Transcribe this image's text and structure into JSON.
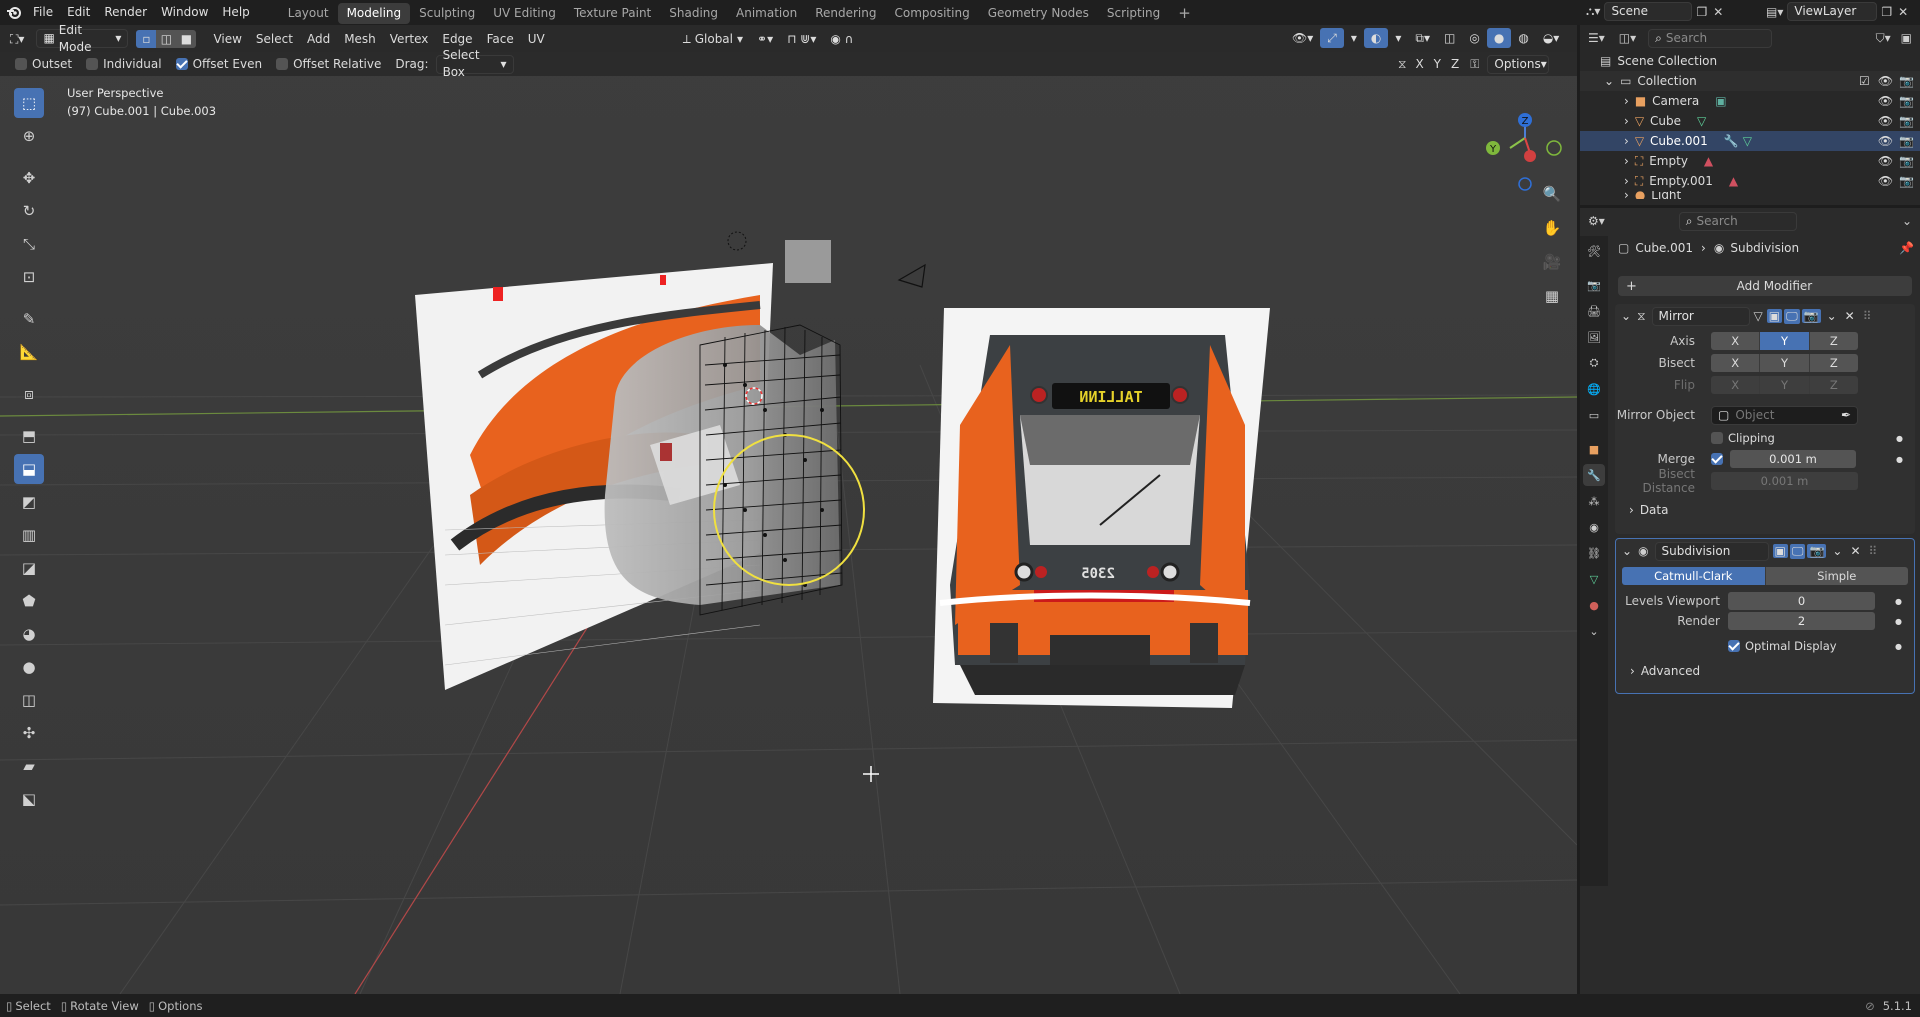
{
  "topbar": {
    "menus": [
      "File",
      "Edit",
      "Render",
      "Window",
      "Help"
    ],
    "workspaces": [
      "Layout",
      "Modeling",
      "Sculpting",
      "UV Editing",
      "Texture Paint",
      "Shading",
      "Animation",
      "Rendering",
      "Compositing",
      "Geometry Nodes",
      "Scripting"
    ],
    "active_workspace": "Modeling",
    "scene": "Scene",
    "view_layer": "ViewLayer"
  },
  "viewport_header": {
    "mode": "Edit Mode",
    "menus": [
      "View",
      "Select",
      "Add",
      "Mesh",
      "Vertex",
      "Edge",
      "Face",
      "UV"
    ],
    "orientation": "Global"
  },
  "tool_settings": {
    "outset": "Outset",
    "individual": "Individual",
    "offset_even": "Offset Even",
    "offset_relative": "Offset Relative",
    "drag_label": "Drag:",
    "drag_value": "Select Box",
    "axis_x": "X",
    "axis_y": "Y",
    "axis_z": "Z",
    "options": "Options"
  },
  "overlay": {
    "view_name": "User Perspective",
    "object_info": "(97) Cube.001 | Cube.003"
  },
  "train_image": {
    "destination": "TALLINN",
    "number": "2305"
  },
  "outliner": {
    "search_placeholder": "Search",
    "root": "Scene Collection",
    "collection": "Collection",
    "items": [
      "Camera",
      "Cube",
      "Cube.001",
      "Empty",
      "Empty.001",
      "Light"
    ]
  },
  "properties": {
    "search_placeholder": "Search",
    "breadcrumb_object": "Cube.001",
    "breadcrumb_modifier": "Subdivision",
    "add_modifier": "Add Modifier",
    "mirror": {
      "name": "Mirror",
      "axis_label": "Axis",
      "bisect_label": "Bisect",
      "flip_label": "Flip",
      "x": "X",
      "y": "Y",
      "z": "Z",
      "mirror_object_label": "Mirror Object",
      "mirror_object_placeholder": "Object",
      "clipping": "Clipping",
      "merge_label": "Merge",
      "merge_value": "0.001 m",
      "bisect_distance_label": "Bisect Distance",
      "bisect_distance_value": "0.001 m",
      "data": "Data"
    },
    "subdivision": {
      "name": "Subdivision",
      "catmull": "Catmull-Clark",
      "simple": "Simple",
      "levels_label": "Levels Viewport",
      "levels_value": "0",
      "render_label": "Render",
      "render_value": "2",
      "optimal": "Optimal Display",
      "advanced": "Advanced"
    }
  },
  "statusbar": {
    "select": "Select",
    "rotate": "Rotate View",
    "options": "Options",
    "version": "5.1.1"
  },
  "colors": {
    "accent": "#4772b3",
    "viewport": "#3a3a3a",
    "orange": "#e8621e"
  }
}
